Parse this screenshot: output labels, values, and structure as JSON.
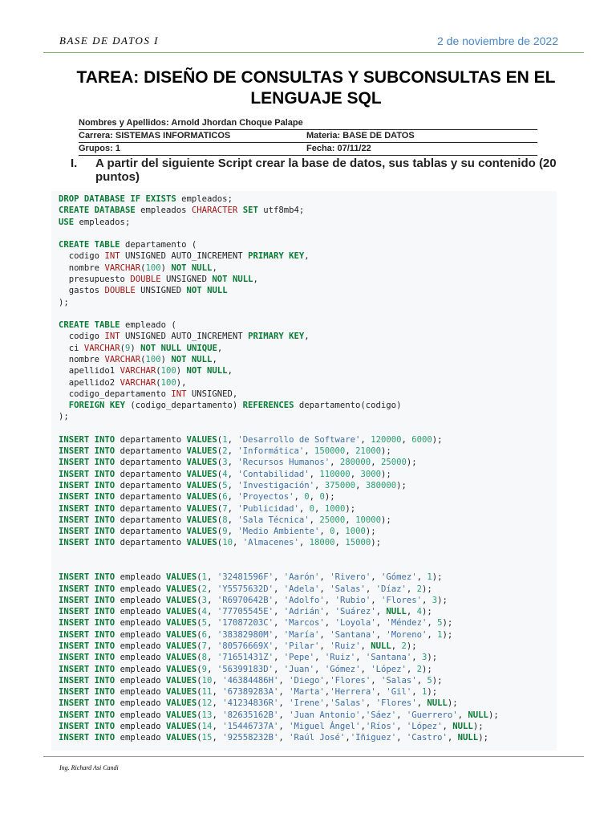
{
  "header": {
    "left": "BASE DE DATOS I",
    "right": "2 de noviembre de 2022"
  },
  "title": "TAREA: DISEÑO DE CONSULTAS Y SUBCONSULTAS EN EL LENGUAJE SQL",
  "info": {
    "names": "Nombres y Apellidos: Arnold Jhordan Choque Palape",
    "career": "Carrera: SISTEMAS INFORMATICOS",
    "subject": "Materia: BASE DE DATOS",
    "group": "Grupos: 1",
    "date": "Fecha:  07/11/22"
  },
  "section": {
    "number": "I.",
    "text": "A partir del siguiente Script crear la base de datos, sus tablas y su contenido (20 puntos)"
  },
  "code_lines": [
    "DROP DATABASE IF EXISTS empleados;",
    "CREATE DATABASE empleados CHARACTER SET utf8mb4;",
    "USE empleados;",
    "",
    "CREATE TABLE departamento (",
    "  codigo INT UNSIGNED AUTO_INCREMENT PRIMARY KEY,",
    "  nombre VARCHAR(100) NOT NULL,",
    "  presupuesto DOUBLE UNSIGNED NOT NULL,",
    "  gastos DOUBLE UNSIGNED NOT NULL",
    ");",
    "",
    "CREATE TABLE empleado (",
    "  codigo INT UNSIGNED AUTO_INCREMENT PRIMARY KEY,",
    "  ci VARCHAR(9) NOT NULL UNIQUE,",
    "  nombre VARCHAR(100) NOT NULL,",
    "  apellido1 VARCHAR(100) NOT NULL,",
    "  apellido2 VARCHAR(100),",
    "  codigo_departamento INT UNSIGNED,",
    "  FOREIGN KEY (codigo_departamento) REFERENCES departamento(codigo)",
    ");",
    "",
    "INSERT INTO departamento VALUES(1, 'Desarrollo de Software', 120000, 6000);",
    "INSERT INTO departamento VALUES(2, 'Informática', 150000, 21000);",
    "INSERT INTO departamento VALUES(3, 'Recursos Humanos', 280000, 25000);",
    "INSERT INTO departamento VALUES(4, 'Contabilidad', 110000, 3000);",
    "INSERT INTO departamento VALUES(5, 'Investigación', 375000, 380000);",
    "INSERT INTO departamento VALUES(6, 'Proyectos', 0, 0);",
    "INSERT INTO departamento VALUES(7, 'Publicidad', 0, 1000);",
    "INSERT INTO departamento VALUES(8, 'Sala Técnica', 25000, 10000);",
    "INSERT INTO departamento VALUES(9, 'Medio Ambiente', 0, 1000);",
    "INSERT INTO departamento VALUES(10, 'Almacenes', 18000, 15000);",
    "",
    "",
    "INSERT INTO empleado VALUES(1, '32481596F', 'Aarón', 'Rivero', 'Gómez', 1);",
    "INSERT INTO empleado VALUES(2, 'Y5575632D', 'Adela', 'Salas', 'Díaz', 2);",
    "INSERT INTO empleado VALUES(3, 'R6970642B', 'Adolfo', 'Rubio', 'Flores', 3);",
    "INSERT INTO empleado VALUES(4, '77705545E', 'Adrián', 'Suárez', NULL, 4);",
    "INSERT INTO empleado VALUES(5, '17087203C', 'Marcos', 'Loyola', 'Méndez', 5);",
    "INSERT INTO empleado VALUES(6, '38382980M', 'María', 'Santana', 'Moreno', 1);",
    "INSERT INTO empleado VALUES(7, '80576669X', 'Pilar', 'Ruiz', NULL, 2);",
    "INSERT INTO empleado VALUES(8, '71651431Z', 'Pepe', 'Ruiz', 'Santana', 3);",
    "INSERT INTO empleado VALUES(9, '56399183D', 'Juan', 'Gómez', 'López', 2);",
    "INSERT INTO empleado VALUES(10, '46384486H', 'Diego','Flores', 'Salas', 5);",
    "INSERT INTO empleado VALUES(11, '67389283A', 'Marta','Herrera', 'Gil', 1);",
    "INSERT INTO empleado VALUES(12, '41234836R', 'Irene','Salas', 'Flores', NULL);",
    "INSERT INTO empleado VALUES(13, '82635162B', 'Juan Antonio','Sáez', 'Guerrero', NULL);",
    "INSERT INTO empleado VALUES(14, '15446737A', 'Miguel Ángel','Ríos', 'López', NULL);",
    "INSERT INTO empleado VALUES(15, '92558232B', 'Raúl José','Iñiguez', 'Castro', NULL);"
  ],
  "footer": "Ing. Richard Asi Candi",
  "colors": {
    "keyword": "#0a7a35",
    "type": "#a31515",
    "number": "#2a9d6f",
    "string": "#3f6fa6",
    "header_rule": "#8db36b",
    "date": "#4a86c5"
  }
}
